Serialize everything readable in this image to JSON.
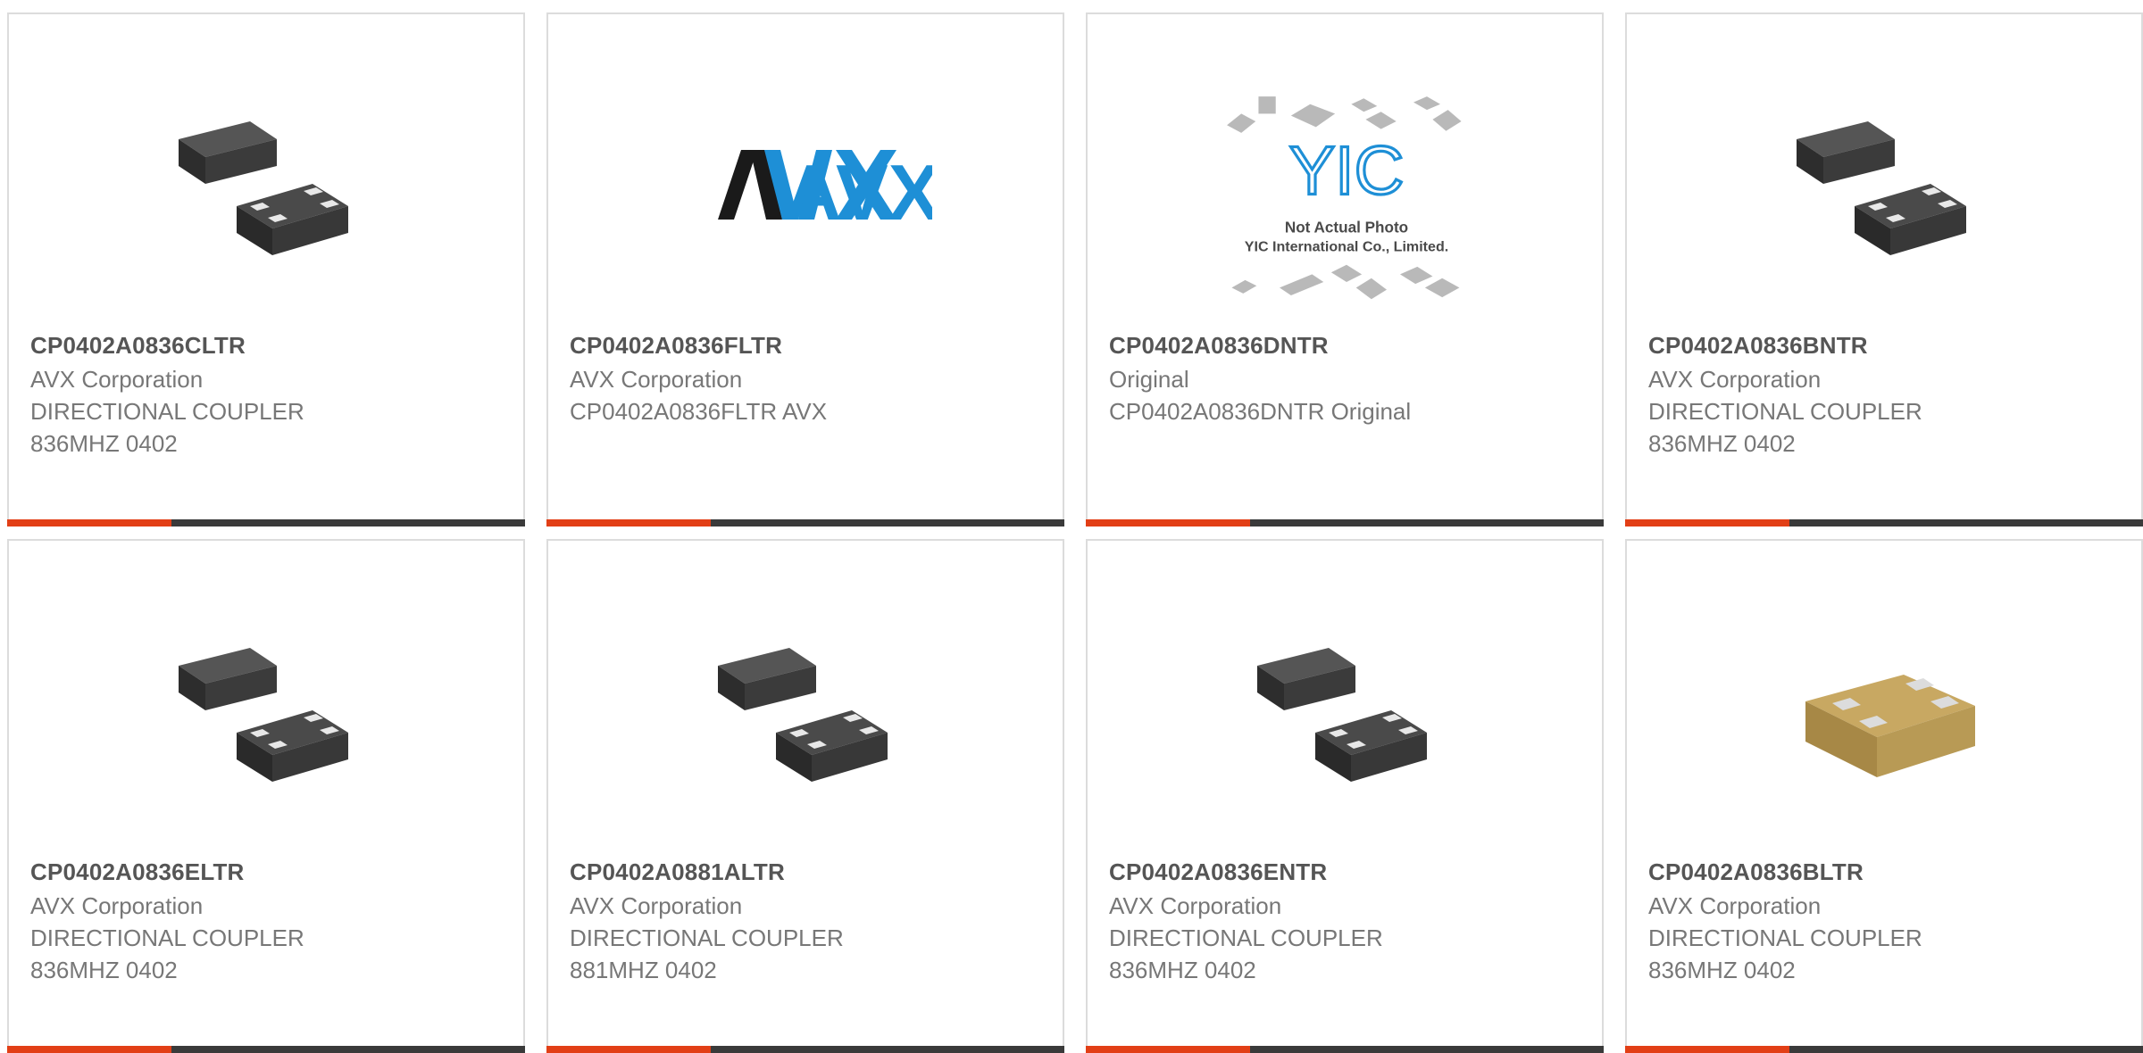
{
  "products": [
    {
      "part": "CP0402A0836CLTR",
      "maker": "AVX Corporation",
      "desc1": "DIRECTIONAL COUPLER",
      "desc2": "836MHZ 0402",
      "image": "black-chip-image"
    },
    {
      "part": "CP0402A0836FLTR",
      "maker": "AVX Corporation",
      "desc1": "CP0402A0836FLTR AVX",
      "desc2": "",
      "image": "avx-logo",
      "logo_text": "AVX"
    },
    {
      "part": "CP0402A0836DNTR",
      "maker": "Original",
      "desc1": "CP0402A0836DNTR Original",
      "desc2": "",
      "image": "yic-placeholder",
      "logo_text": "YIC",
      "caption1": "Not Actual Photo",
      "caption2": "YIC International Co., Limited."
    },
    {
      "part": "CP0402A0836BNTR",
      "maker": "AVX Corporation",
      "desc1": "DIRECTIONAL COUPLER",
      "desc2": "836MHZ 0402",
      "image": "black-chip-image"
    },
    {
      "part": "CP0402A0836ELTR",
      "maker": "AVX Corporation",
      "desc1": "DIRECTIONAL COUPLER",
      "desc2": "836MHZ 0402",
      "image": "black-chip-image"
    },
    {
      "part": "CP0402A0881ALTR",
      "maker": "AVX Corporation",
      "desc1": "DIRECTIONAL COUPLER",
      "desc2": "881MHZ 0402",
      "image": "black-chip-image"
    },
    {
      "part": "CP0402A0836ENTR",
      "maker": "AVX Corporation",
      "desc1": "DIRECTIONAL COUPLER",
      "desc2": "836MHZ 0402",
      "image": "black-chip-image"
    },
    {
      "part": "CP0402A0836BLTR",
      "maker": "AVX Corporation",
      "desc1": "DIRECTIONAL COUPLER",
      "desc2": "836MHZ 0402",
      "image": "gold-chip-image"
    }
  ],
  "colors": {
    "accent": "#e23f16",
    "bar": "#3a3a3a",
    "border": "#dcdcdc",
    "avx_blue": "#1e8fd6"
  }
}
